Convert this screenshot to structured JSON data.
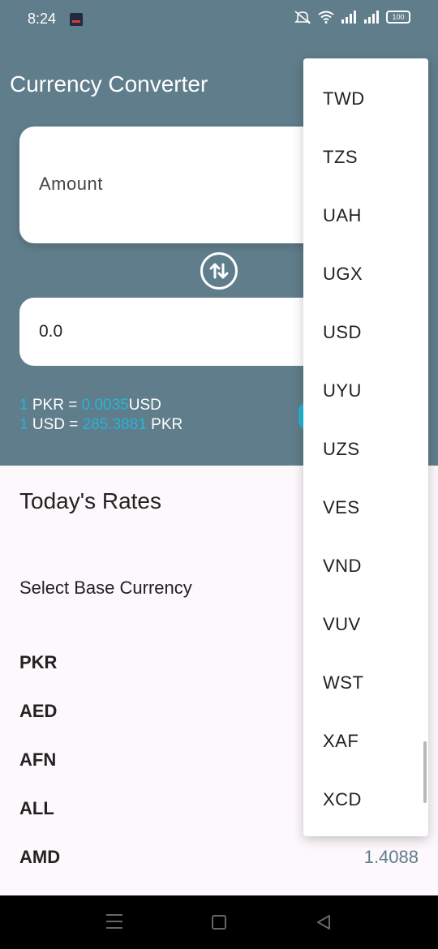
{
  "status": {
    "time": "8:24",
    "battery": "100",
    "icons": [
      "app-notification-icon",
      "mute-icon",
      "wifi-icon",
      "signal-icon",
      "signal-icon",
      "battery-icon"
    ]
  },
  "app": {
    "title": "Currency Converter"
  },
  "converter": {
    "amount_placeholder": "Amount",
    "result_value": "0.0",
    "swap_icon": "swap-vertical-icon",
    "rate1": {
      "qty": "1",
      "from": "PKR =",
      "value": "0.0035",
      "to": "USD"
    },
    "rate2": {
      "qty": "1",
      "from": "USD =",
      "value": "285.3881",
      "to": "PKR"
    }
  },
  "rates": {
    "title": "Today's Rates",
    "base_label": "Select Base Currency",
    "currencies": [
      "PKR",
      "AED",
      "AFN",
      "ALL",
      "AMD"
    ],
    "amd_rate": "1.4088"
  },
  "dropdown": {
    "items": [
      "TWD",
      "TZS",
      "UAH",
      "UGX",
      "USD",
      "UYU",
      "UZS",
      "VES",
      "VND",
      "VUV",
      "WST",
      "XAF",
      "XCD"
    ]
  },
  "navigation": {
    "icons": [
      "menu-icon",
      "home-icon",
      "back-icon"
    ]
  },
  "colors": {
    "header": "#607d8b",
    "accent": "#22b6d6",
    "background": "#fdf8fc"
  }
}
